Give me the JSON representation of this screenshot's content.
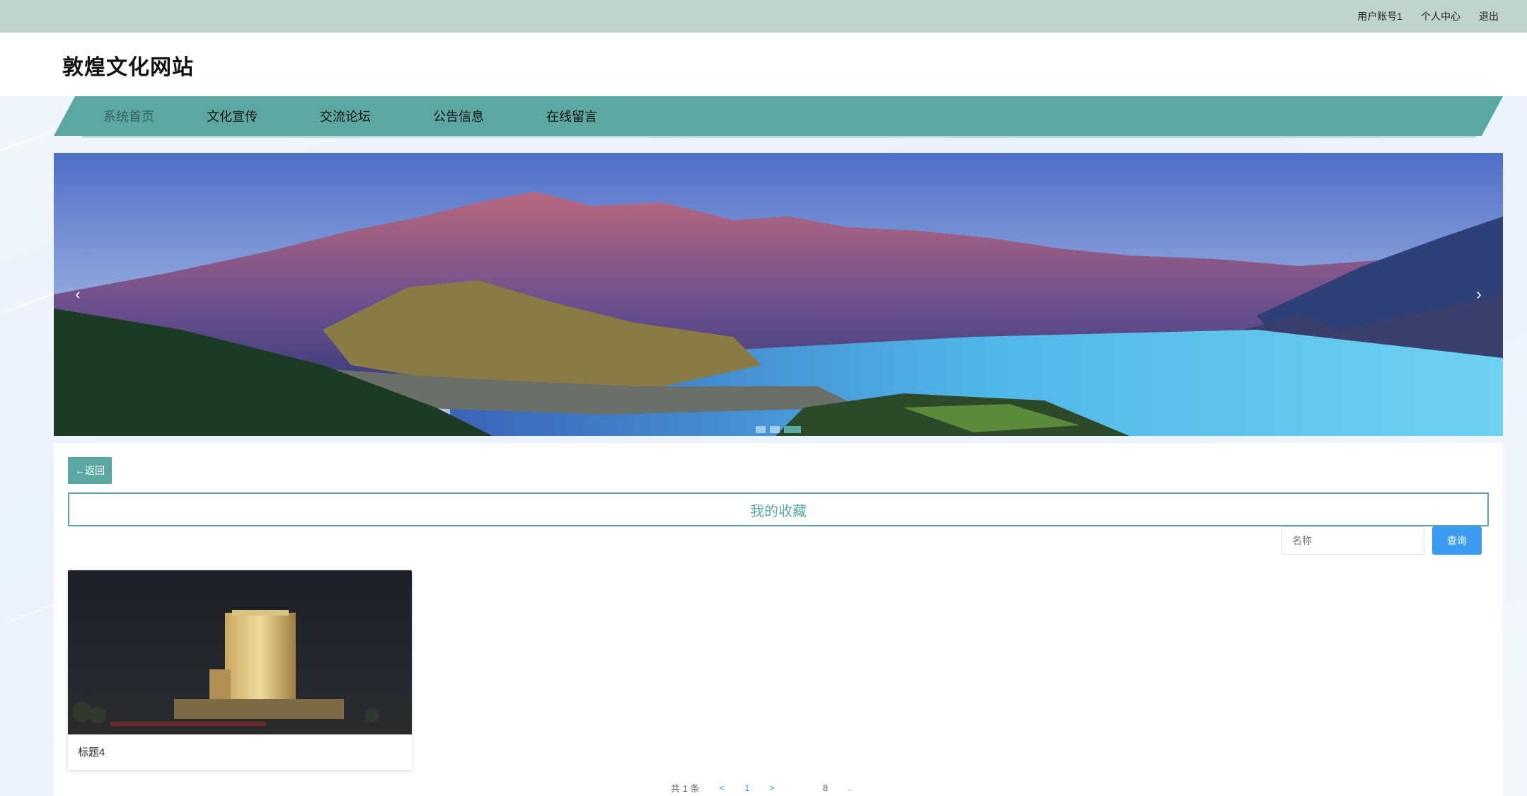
{
  "topbar": {
    "account_label": "用户账号1",
    "profile_label": "个人中心",
    "logout_label": "退出"
  },
  "header": {
    "site_title": "敦煌文化网站"
  },
  "nav": {
    "items": [
      {
        "label": "系统首页"
      },
      {
        "label": "文化宣传"
      },
      {
        "label": "交流论坛"
      },
      {
        "label": "公告信息"
      },
      {
        "label": "在线留言"
      }
    ]
  },
  "banner": {
    "prev_icon": "chevron-left-icon",
    "next_icon": "chevron-right-icon",
    "prev_glyph": "‹",
    "next_glyph": "›",
    "slide_count": 3,
    "active_slide": 3
  },
  "content": {
    "back_label": "←返回",
    "section_title": "我的收藏",
    "search": {
      "placeholder": "名称",
      "button_label": "查询"
    },
    "items": [
      {
        "title": "标题4"
      }
    ],
    "pagination": {
      "total_label": "共 1 条",
      "prev": "<",
      "current_page": "1",
      "next": ">",
      "page_size": "8",
      "dropdown_icon": "chevron-down-icon",
      "dropdown_glyph": "⌄"
    }
  },
  "colors": {
    "accent": "#5ba8a2",
    "topbar": "#bfd2cb",
    "button_blue": "#3a9bf0"
  }
}
